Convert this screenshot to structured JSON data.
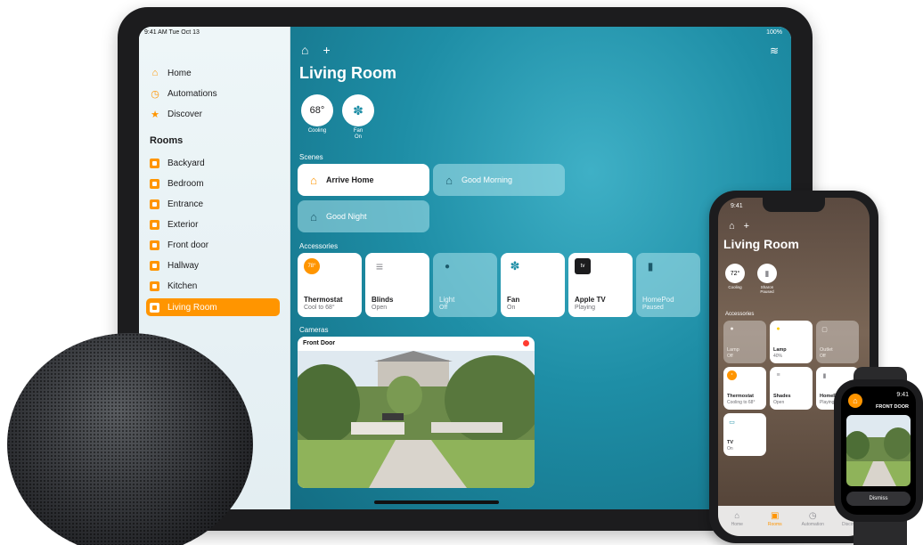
{
  "ipad": {
    "status_time": "9:41 AM  Tue Oct 13",
    "status_battery": "100%",
    "sidebar": {
      "items": [
        {
          "label": "Home",
          "icon": "house-icon"
        },
        {
          "label": "Automations",
          "icon": "clock-icon"
        },
        {
          "label": "Discover",
          "icon": "star-icon"
        }
      ],
      "rooms_heading": "Rooms",
      "rooms": [
        "Backyard",
        "Bedroom",
        "Entrance",
        "Exterior",
        "Front door",
        "Hallway",
        "Kitchen",
        "Living Room"
      ],
      "active_room": "Living Room"
    },
    "main": {
      "title": "Living Room",
      "thermostat_value": "68°",
      "thermostat_caption": "Cooling",
      "fan_caption_1": "Fan",
      "fan_caption_2": "On",
      "scenes_label": "Scenes",
      "scenes": [
        {
          "label": "Arrive Home",
          "state": "on"
        },
        {
          "label": "Good Morning",
          "state": "off"
        },
        {
          "label": "Good Night",
          "state": "off"
        }
      ],
      "accessories_label": "Accessories",
      "accessories": [
        {
          "name": "Thermostat",
          "status": "Cool to 68°",
          "state": "on",
          "icon_text": "78°"
        },
        {
          "name": "Blinds",
          "status": "Open",
          "state": "on",
          "icon_text": "≡"
        },
        {
          "name": "Light",
          "status": "Off",
          "state": "off",
          "icon_text": "●"
        },
        {
          "name": "Fan",
          "status": "On",
          "state": "on",
          "icon_text": "✽"
        },
        {
          "name": "Apple TV",
          "status": "Playing",
          "state": "on",
          "icon_text": "tv"
        },
        {
          "name": "HomePod",
          "status": "Paused",
          "state": "off",
          "icon_text": "▮"
        }
      ],
      "cameras_label": "Cameras",
      "camera_name": "Front Door"
    }
  },
  "iphone": {
    "status_time": "9:41",
    "title": "Living Room",
    "thermostat_value": "72°",
    "thermostat_caption": "Cooling",
    "homepod_caption": "Sharon Paused",
    "section_label": "Accessories",
    "tiles": [
      {
        "name": "Lamp",
        "status": "Off",
        "state": "off"
      },
      {
        "name": "Lamp",
        "status": "40%",
        "state": "on"
      },
      {
        "name": "Outlet",
        "status": "Off",
        "state": "off"
      },
      {
        "name": "Thermostat",
        "status": "Cooling to 68°",
        "state": "on"
      },
      {
        "name": "Shades",
        "status": "Open",
        "state": "on"
      },
      {
        "name": "HomePod",
        "status": "Playing",
        "state": "on"
      },
      {
        "name": "TV",
        "status": "On",
        "state": "on"
      }
    ],
    "tabs": [
      {
        "label": "Home",
        "icon": "⌂"
      },
      {
        "label": "Rooms",
        "icon": "▣"
      },
      {
        "label": "Automation",
        "icon": "◷"
      },
      {
        "label": "Discover",
        "icon": "★"
      }
    ],
    "active_tab": "Rooms"
  },
  "watch": {
    "time": "9:41",
    "camera_label": "FRONT DOOR",
    "dismiss_label": "Dismiss"
  },
  "colors": {
    "accent": "#ff9500",
    "ipad_main_bg": "#1e8ea6",
    "record_dot": "#ff3b30"
  }
}
